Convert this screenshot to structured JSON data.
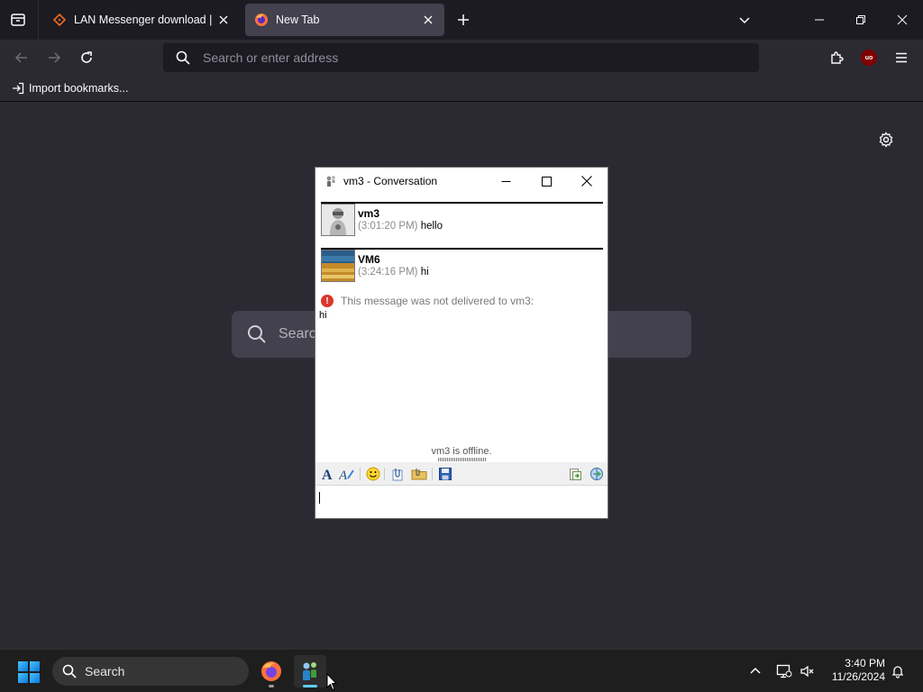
{
  "browser": {
    "tabs": [
      {
        "label": "LAN Messenger download | So"
      },
      {
        "label": "New Tab"
      }
    ],
    "address": {
      "placeholder": "Search or enter address",
      "value": ""
    },
    "bookmarks": {
      "import_label": "Import bookmarks..."
    },
    "extensions": {
      "ublock_badge": "uo"
    },
    "newtab_search": {
      "placeholder": "Search"
    }
  },
  "conversation": {
    "title": "vm3 - Conversation",
    "messages": [
      {
        "sender": "vm3",
        "time": "(3:01:20 PM)",
        "text": "hello"
      },
      {
        "sender": "VM6",
        "time": "(3:24:16 PM)",
        "text": "hi"
      }
    ],
    "error": {
      "text": "This message was not delivered to vm3:",
      "body": "hi"
    },
    "status": "vm3 is offline.",
    "input_value": ""
  },
  "taskbar": {
    "search_label": "Search",
    "time": "3:40 PM",
    "date": "11/26/2024"
  },
  "colors": {
    "tab_bar": "#1c1b22",
    "chrome": "#2b2a33",
    "active_tab": "#42414d",
    "error_red": "#d9382b",
    "taskbar": "#1e1e1e"
  }
}
